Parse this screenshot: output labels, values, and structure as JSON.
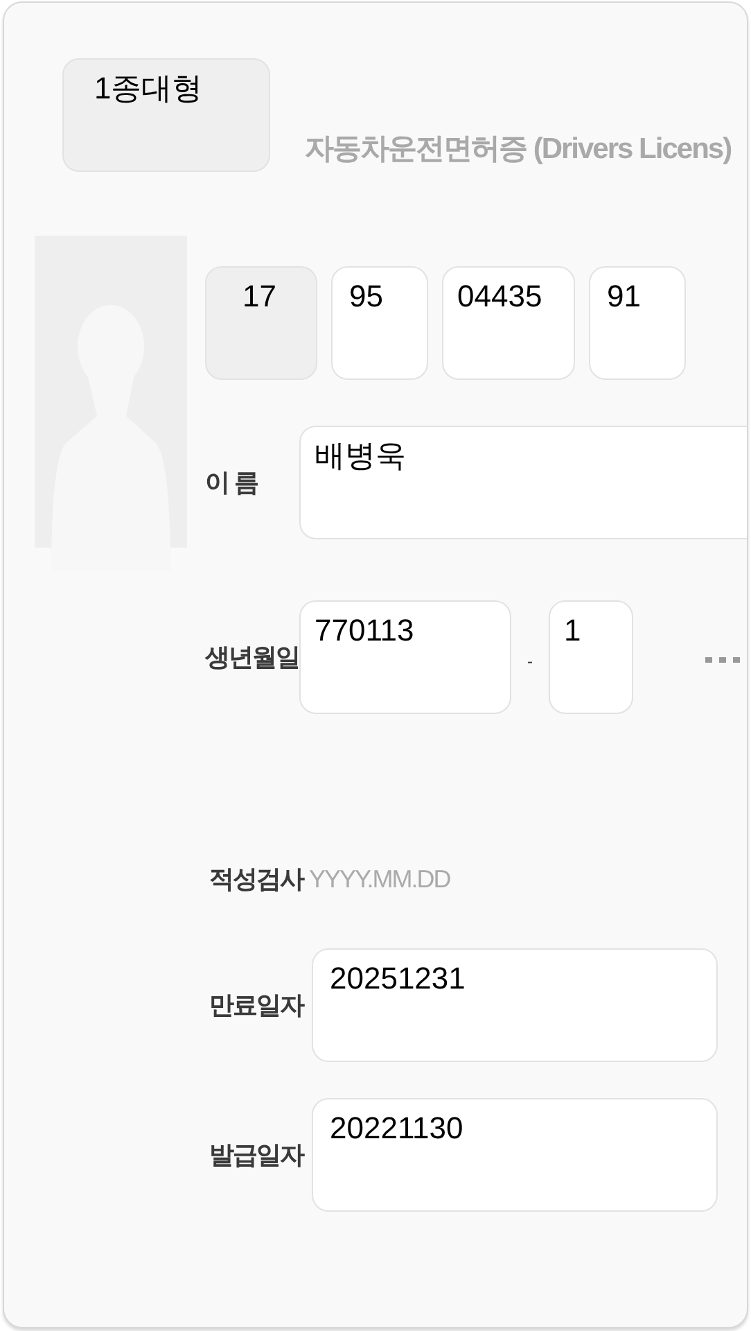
{
  "license_type": {
    "value": "1종대형",
    "disabled": true
  },
  "title": "자동차운전면허증 (Drivers Licens)",
  "license_number": [
    {
      "value": "17",
      "disabled": true
    },
    {
      "value": "95",
      "disabled": false
    },
    {
      "value": "04435",
      "disabled": false
    },
    {
      "value": "91",
      "disabled": false
    }
  ],
  "identity_fields": [
    {
      "kind": "wide",
      "label": "이 름",
      "value": "배병욱"
    },
    {
      "kind": "split",
      "label": "생년월일",
      "value": "770113",
      "separator": "-",
      "second_value": "1",
      "masked": true
    }
  ],
  "date_fields": [
    {
      "kind": "placeholder",
      "label": "적성검사",
      "placeholder": "YYYY.MM.DD"
    },
    {
      "kind": "date",
      "label": "만료일자",
      "value": "20251231"
    },
    {
      "kind": "date",
      "label": "발급일자",
      "value": "20221130"
    }
  ]
}
